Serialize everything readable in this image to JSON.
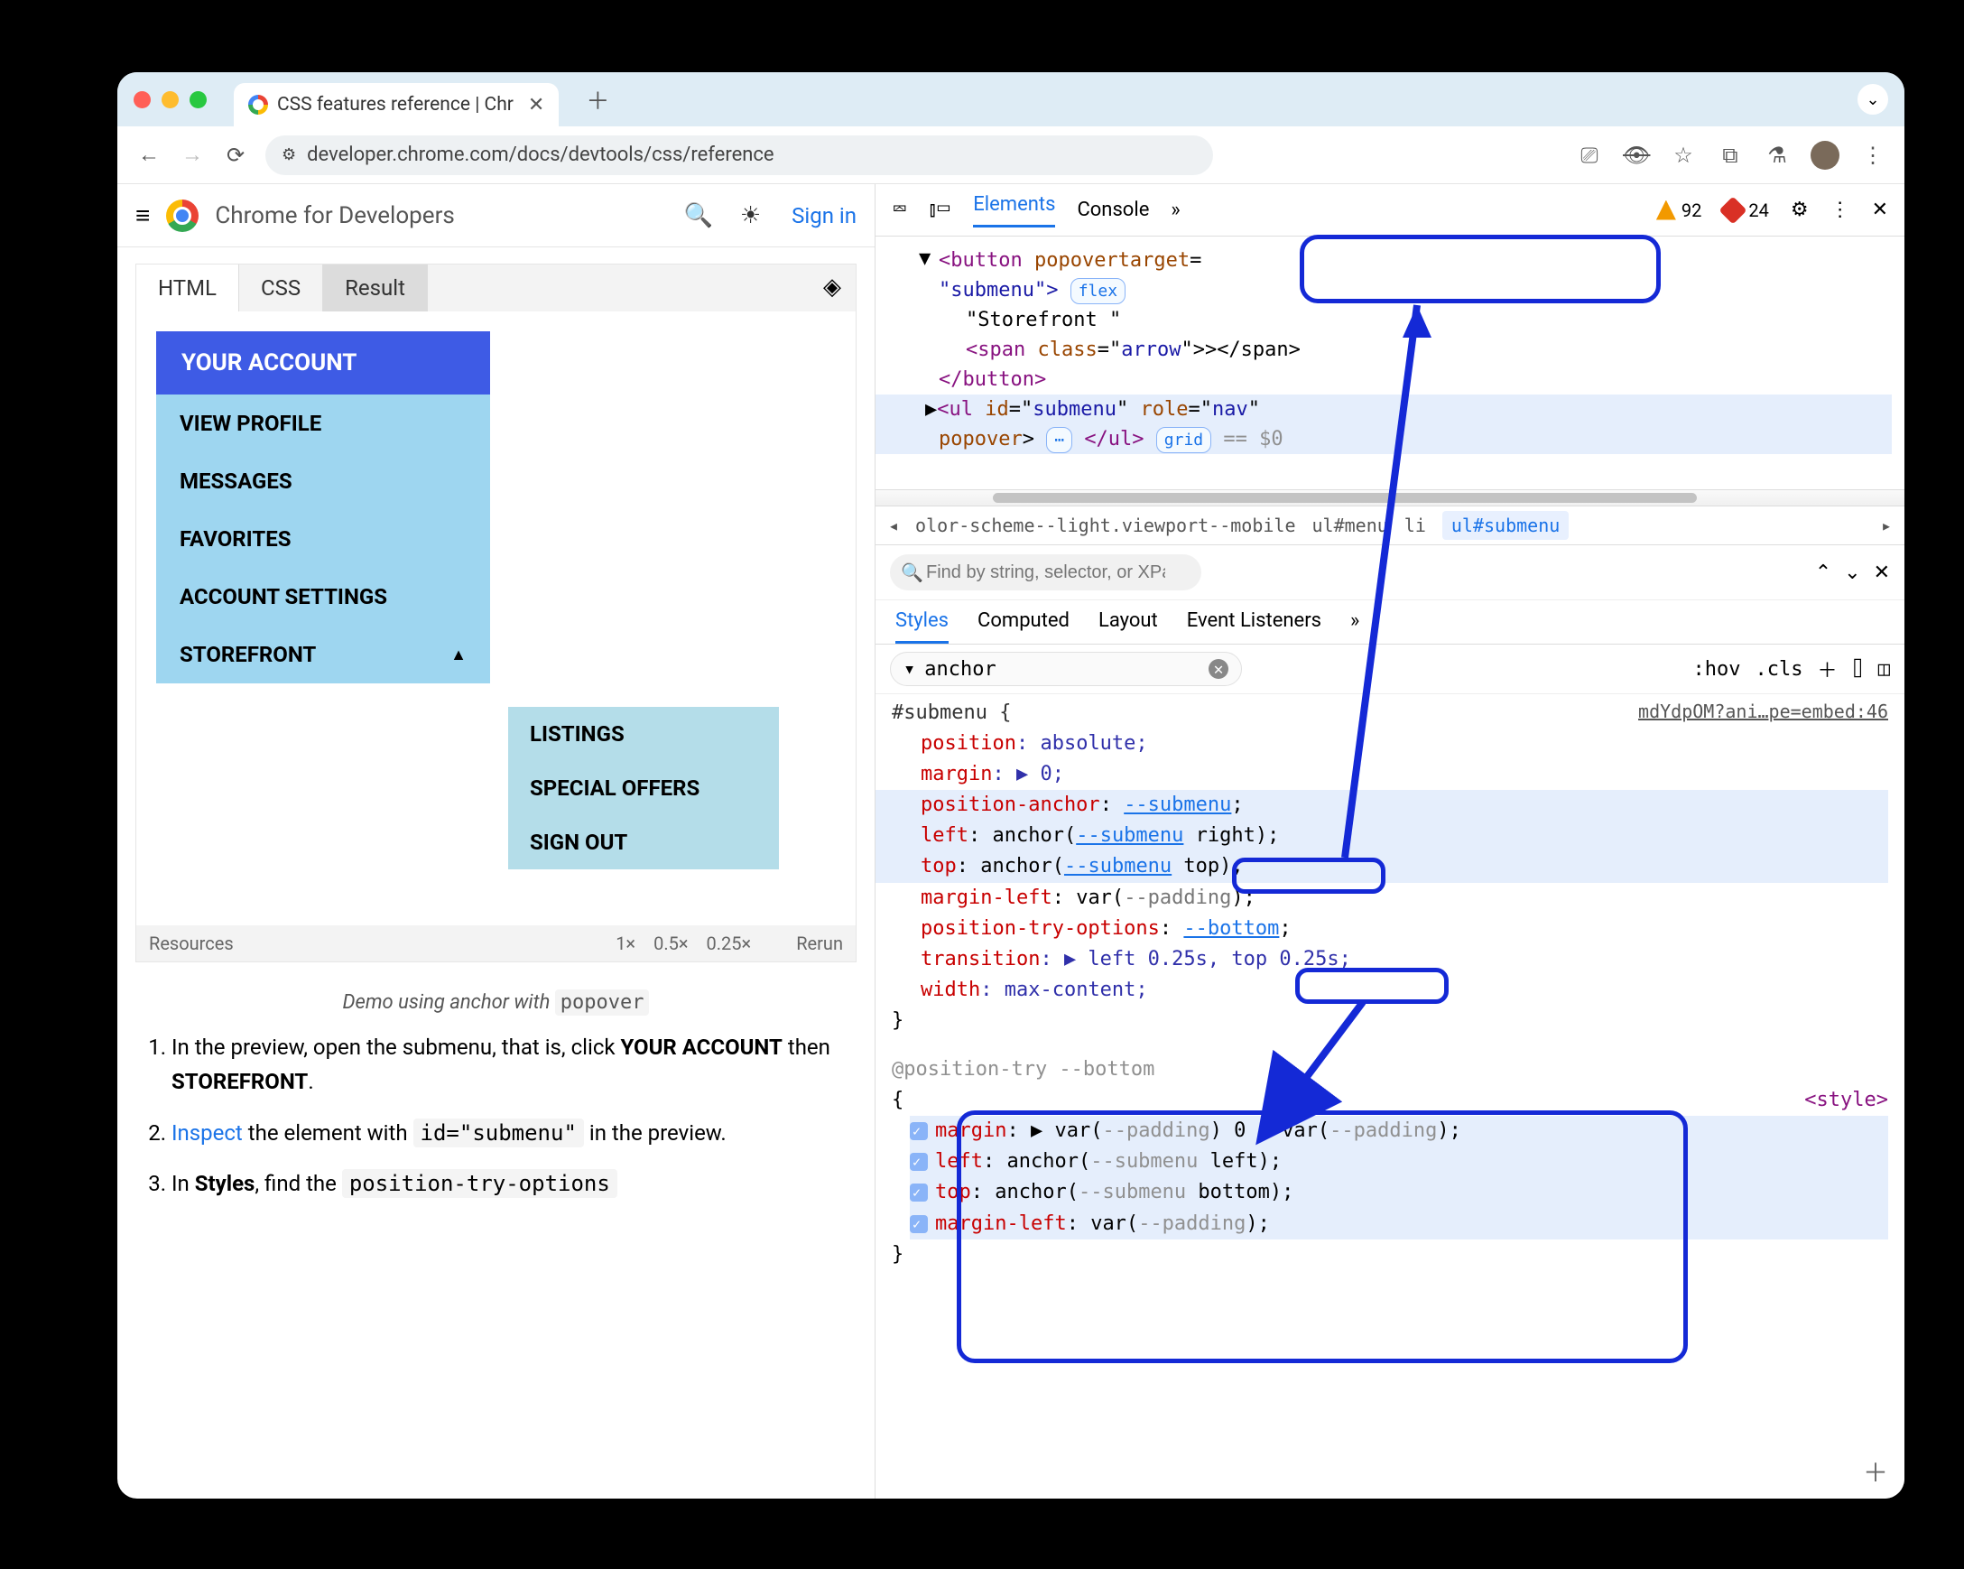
{
  "tab": {
    "title": "CSS features reference  |  Chr"
  },
  "nav": {
    "url": "developer.chrome.com/docs/devtools/css/reference"
  },
  "page": {
    "brand": "Chrome for Developers",
    "signin": "Sign in",
    "example_tabs": {
      "html": "HTML",
      "css": "CSS",
      "result": "Result"
    },
    "menu": {
      "head": "YOUR ACCOUNT",
      "items": [
        "VIEW PROFILE",
        "MESSAGES",
        "FAVORITES",
        "ACCOUNT SETTINGS",
        "STOREFRONT"
      ],
      "sub": [
        "LISTINGS",
        "SPECIAL OFFERS",
        "SIGN OUT"
      ]
    },
    "footer": {
      "resources": "Resources",
      "scales": [
        "1×",
        "0.5×",
        "0.25×"
      ],
      "rerun": "Rerun"
    },
    "caption_pre": "Demo using anchor with ",
    "caption_code": "popover",
    "steps": {
      "s1a": "In the preview, open the submenu, that is, click ",
      "s1b": "YOUR ACCOUNT",
      "s1c": " then ",
      "s1d": "STOREFRONT",
      "s1e": ".",
      "s2a": "Inspect",
      "s2b": " the element with ",
      "s2c": "id=\"submenu\"",
      "s2d": " in the preview.",
      "s3a": "In ",
      "s3b": "Styles",
      "s3c": ", find the ",
      "s3d": "position-try-options"
    }
  },
  "devtools": {
    "toolbar": {
      "elements": "Elements",
      "console": "Console",
      "warn": "92",
      "err": "24"
    },
    "dom": {
      "l1a": "<button",
      "l1b": " popovertarget",
      "l1c": "=",
      "l2a": "\"",
      "l2b": "submenu",
      "l2c": "\">",
      "l2pill": "flex",
      "l3": "  \"Storefront \"",
      "l4a": "<span",
      "l4b": " class",
      "l4c": "=\"",
      "l4d": "arrow",
      "l4e": "\">></span>",
      "l5": "</button>",
      "l6a": "<ul",
      "l6b": " id",
      "l6c": "=\"",
      "l6d": "submenu",
      "l6e": "\" ",
      "l6f": "role",
      "l6g": "=\"",
      "l6h": "nav",
      "l6i": "\"",
      "l7a": "popover",
      "l7b": ">",
      "l7pill": "grid",
      "l7c": "</ul>",
      "l7d": " == $0"
    },
    "breadcrumb": {
      "b1": "olor-scheme--light.viewport--mobile",
      "b2": "ul#menu",
      "b3": "li",
      "b4": "ul#submenu"
    },
    "search": {
      "placeholder": "Find by string, selector, or XPath"
    },
    "subtabs": {
      "styles": "Styles",
      "computed": "Computed",
      "layout": "Layout",
      "events": "Event Listeners"
    },
    "filter": {
      "value": "anchor",
      "hov": ":hov",
      "cls": ".cls"
    },
    "css": {
      "source": "mdYdpOM?ani…pe=embed:46",
      "selector": "#submenu {",
      "lines": [
        {
          "p": "position",
          "v": ": absolute;"
        },
        {
          "p": "margin",
          "v": ": ▶ 0;"
        },
        {
          "p": "position-anchor",
          "v": ": ",
          "link": "--submenu",
          "tail": ";"
        },
        {
          "p": "left",
          "v": ": anchor(",
          "link": "--submenu",
          "tail": " right);"
        },
        {
          "p": "top",
          "v": ": anchor(",
          "link": "--submenu",
          "tail": " top);"
        },
        {
          "p": "margin-left",
          "v": ": var(",
          "link": "--padding",
          "tail": ");"
        },
        {
          "p": "position-try-options",
          "v": ": ",
          "link": "--bottom",
          "tail": ";"
        },
        {
          "p": "transition",
          "v": ": ▶ left 0.25s, top 0.25s;"
        },
        {
          "p": "width",
          "v": ": max-content;"
        }
      ],
      "close": "}",
      "try_head": "@position-try --bottom",
      "try_open": "{",
      "try_lines": [
        {
          "p": "margin",
          "v": ": ▶ var(",
          "l1": "--padding",
          "m": ") 0 0 var(",
          "l2": "--padding",
          "t": ");"
        },
        {
          "p": "left",
          "v": ": anchor(",
          "l1": "--submenu",
          "m": " left);",
          "l2": "",
          "t": ""
        },
        {
          "p": "top",
          "v": ": anchor(",
          "l1": "--submenu",
          "m": " bottom);",
          "l2": "",
          "t": ""
        },
        {
          "p": "margin-left",
          "v": ": var(",
          "l1": "--padding",
          "m": ");",
          "l2": "",
          "t": ""
        }
      ],
      "try_close": "}",
      "styletag": "<style>"
    }
  }
}
